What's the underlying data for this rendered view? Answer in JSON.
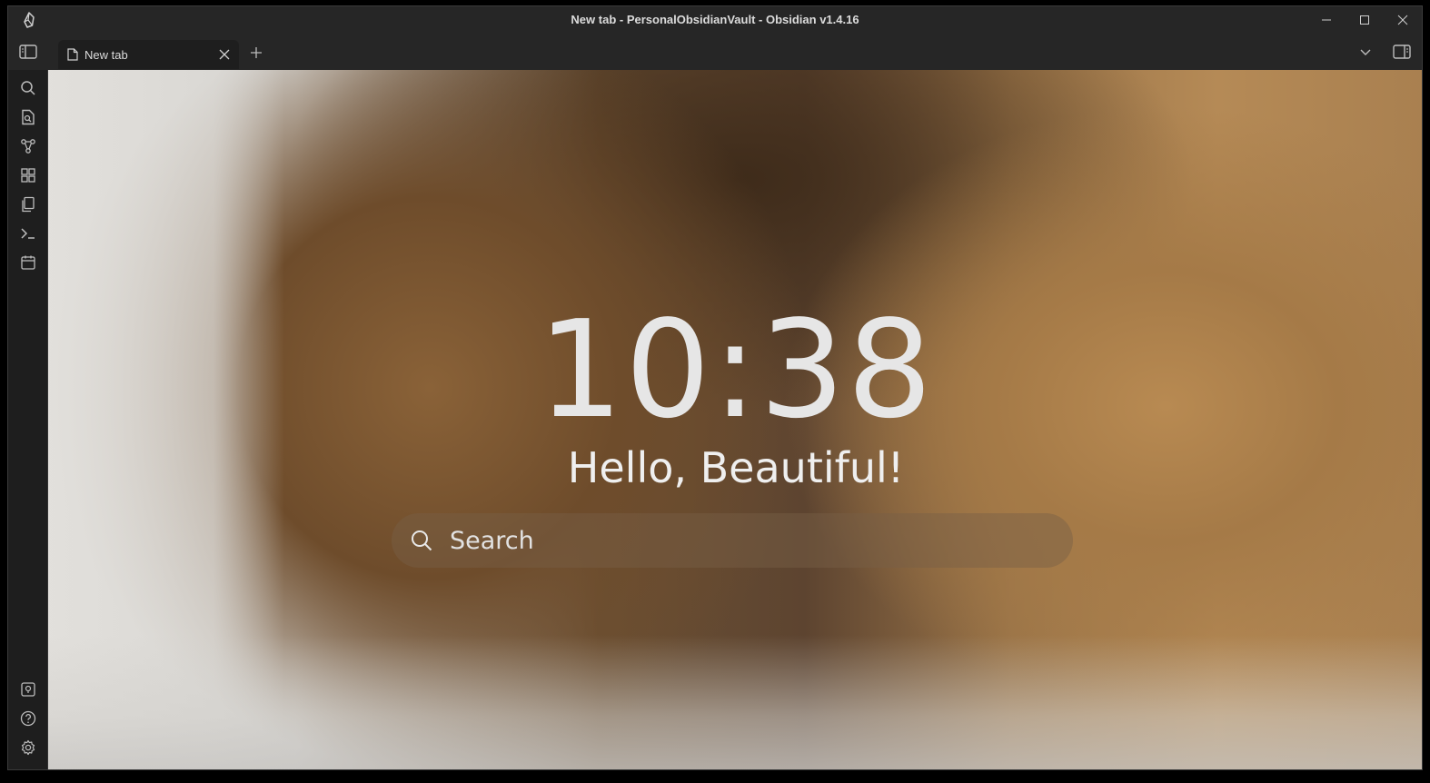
{
  "window": {
    "title": "New tab - PersonalObsidianVault - Obsidian v1.4.16"
  },
  "tabs": [
    {
      "label": "New tab",
      "active": true
    }
  ],
  "ribbon": {
    "top_icons": [
      "search-icon",
      "quick-switcher-icon",
      "graph-view-icon",
      "canvas-icon",
      "templates-icon",
      "command-palette-icon",
      "daily-note-calendar-icon"
    ],
    "bottom_icons": [
      "vault-switcher-icon",
      "help-icon",
      "settings-icon"
    ]
  },
  "homepage": {
    "clock": "10:38",
    "greeting": "Hello, Beautiful!",
    "search_placeholder": "Search"
  },
  "colors": {
    "chrome_bg": "#262626",
    "ribbon_bg": "#1e1e1e",
    "text": "#dcdcdc"
  }
}
